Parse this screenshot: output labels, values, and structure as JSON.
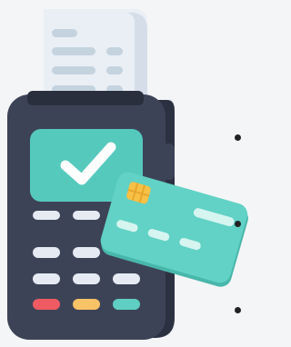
{
  "illustration": {
    "subject": "payment-terminal-with-card",
    "colors": {
      "background": "#f4f5f7",
      "terminal_body": "#3d4357",
      "terminal_side": "#2c3142",
      "screen": "#56c9bd",
      "check": "#ffffff",
      "receipt": "#e9eff5",
      "receipt_lines": "#c5d3df",
      "card": "#61d2c5",
      "card_stripe": "#d6f4f0",
      "chip": "#f7c046",
      "key_light": "#e6eaf2",
      "key_red": "#ef5b62",
      "key_yellow": "#f8c266",
      "key_teal": "#5fcfc3"
    }
  },
  "bullets": [
    {
      "name": "bullet-1",
      "text": ""
    },
    {
      "name": "bullet-2",
      "text": ""
    },
    {
      "name": "bullet-3",
      "text": ""
    }
  ]
}
